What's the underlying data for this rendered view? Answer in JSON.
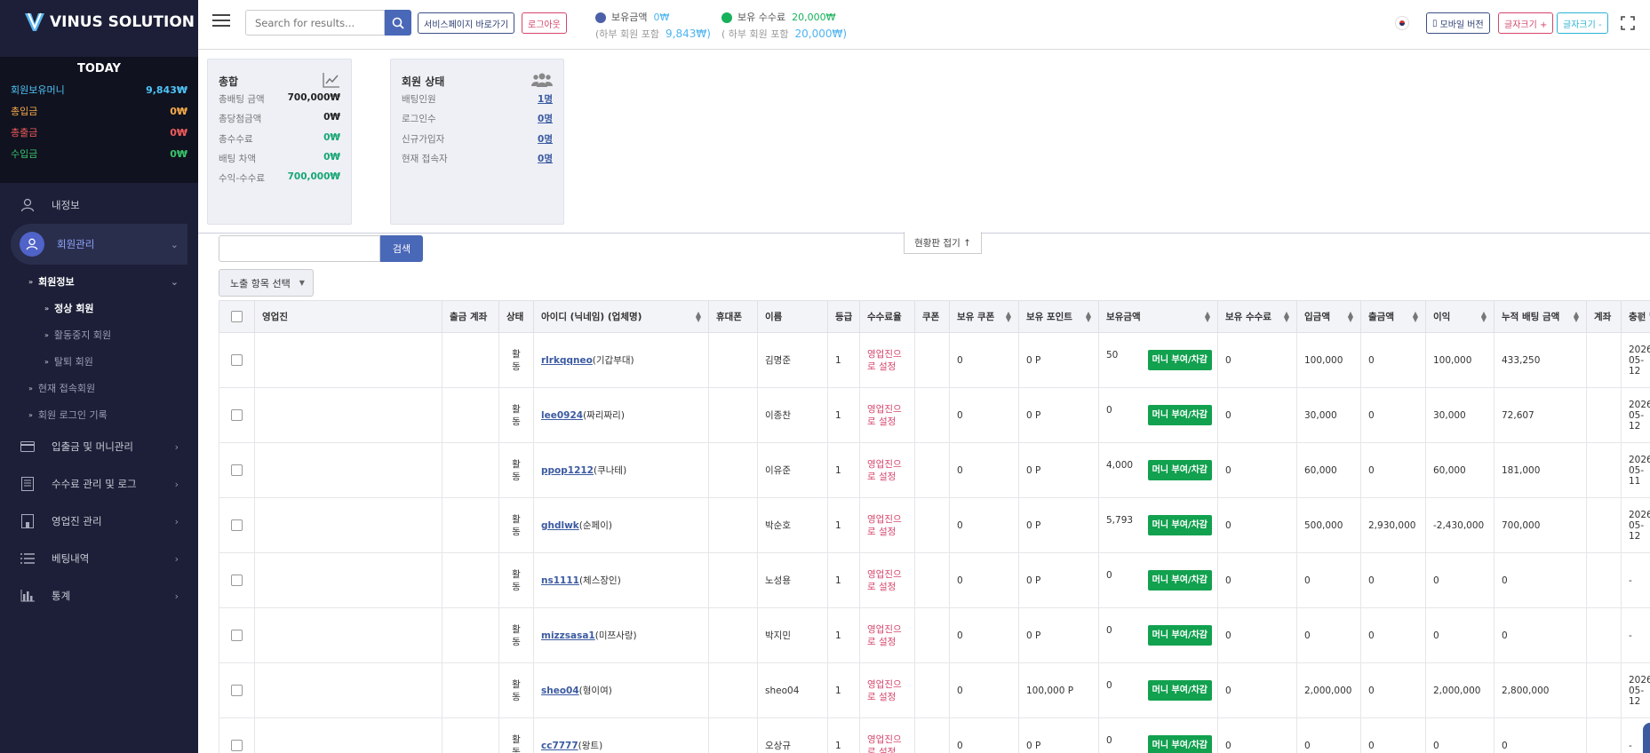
{
  "brand": {
    "name": "VINUS SOLUTION"
  },
  "today": {
    "title": "TODAY",
    "rows": [
      {
        "label": "회원보유머니",
        "value": "9,843₩",
        "color": "#4fc3f7"
      },
      {
        "label": "총입금",
        "value": "0₩",
        "color": "#f5a94a"
      },
      {
        "label": "총출금",
        "value": "0₩",
        "color": "#ef5b5b"
      },
      {
        "label": "수입금",
        "value": "0₩",
        "color": "#37c36b"
      }
    ]
  },
  "menu": {
    "myinfo": "내정보",
    "members": "회원관리",
    "member_info": "회원정보",
    "normal": "정상 회원",
    "suspended": "활동중지 회원",
    "withdrawn": "탈퇴 회원",
    "current": "현재 접속회원",
    "login_log": "회원 로그인 기록",
    "money": "입출금 및 머니관리",
    "fee": "수수료 관리 및 로그",
    "agency": "영업진 관리",
    "betting": "베팅내역",
    "stats": "통계"
  },
  "topbar": {
    "search_placeholder": "Search for results...",
    "service_btn": "서비스페이지 바로가기",
    "logout_btn": "로그아웃",
    "hold_amount_label": "보유금액",
    "hold_amount_value": "0₩",
    "hold_amount_sub": "(하부 회원 포함",
    "hold_amount_sub_value": "9,843₩)",
    "hold_fee_label": "보유 수수료",
    "hold_fee_value": "20,000₩",
    "hold_fee_sub": "( 하부 회원 포함",
    "hold_fee_sub_value": "20,000₩)",
    "mobile_btn": "모바일 버전",
    "font_up": "글자크기 +",
    "font_down": "글자크기 -"
  },
  "summary": {
    "title": "총합",
    "rows": [
      {
        "label": "총배팅 금액",
        "value": "700,000₩",
        "color": "#222"
      },
      {
        "label": "총당첨금액",
        "value": "0₩",
        "color": "#222"
      },
      {
        "label": "총수수료",
        "value": "0₩",
        "color": "#17a673"
      },
      {
        "label": "배팅 차액",
        "value": "0₩",
        "color": "#17a673"
      },
      {
        "label": "수익-수수료",
        "value": "700,000₩",
        "color": "#17a673"
      }
    ]
  },
  "member_status": {
    "title": "회원 상태",
    "rows": [
      {
        "label": "배팅인원",
        "value": "1명"
      },
      {
        "label": "로그인수",
        "value": "0명"
      },
      {
        "label": "신규가입자",
        "value": "0명"
      },
      {
        "label": "현재 접속자",
        "value": "0명"
      }
    ]
  },
  "fold_label": "현황판 접기 ↑",
  "filter": {
    "search_btn": "검색",
    "column_select": "노출 항목 선택"
  },
  "table": {
    "headers": [
      "영업진",
      "출금 계좌",
      "상태",
      "아이디 (닉네임) (업체명)",
      "휴대폰",
      "이름",
      "등급",
      "수수료율",
      "쿠폰",
      "보유 쿠폰",
      "보유 포인트",
      "보유금액",
      "보유 수수료",
      "입금액",
      "출금액",
      "이익",
      "누적 배팅 금액",
      "계좌",
      "충전 날짜"
    ],
    "money_btn": "머니 부여/차감",
    "rows": [
      {
        "status": "활동",
        "id": "rlrkqqneo",
        "nick": "(기갑부대)",
        "name": "김명준",
        "grade": "1",
        "rate": "영업진으로 설정",
        "coupon": "0",
        "point": "0 P",
        "money": "50",
        "fee": "0",
        "deposit": "100,000",
        "withdraw": "0",
        "profit": "100,000",
        "bet": "433,250",
        "date": "2026-05-12"
      },
      {
        "status": "활동",
        "id": "lee0924",
        "nick": "(짜리짜리)",
        "name": "이종찬",
        "grade": "1",
        "rate": "영업진으로 설정",
        "coupon": "0",
        "point": "0 P",
        "money": "0",
        "fee": "0",
        "deposit": "30,000",
        "withdraw": "0",
        "profit": "30,000",
        "bet": "72,607",
        "date": "2026-05-12"
      },
      {
        "status": "활동",
        "id": "ppop1212",
        "nick": "(쿠나테)",
        "name": "이유준",
        "grade": "1",
        "rate": "영업진으로 설정",
        "coupon": "0",
        "point": "0 P",
        "money": "4,000",
        "fee": "0",
        "deposit": "60,000",
        "withdraw": "0",
        "profit": "60,000",
        "bet": "181,000",
        "date": "2026-05-11"
      },
      {
        "status": "활동",
        "id": "ghdlwk",
        "nick": "(순페이)",
        "name": "박순호",
        "grade": "1",
        "rate": "영업진으로 설정",
        "coupon": "0",
        "point": "0 P",
        "money": "5,793",
        "fee": "0",
        "deposit": "500,000",
        "withdraw": "2,930,000",
        "profit": "-2,430,000",
        "bet": "700,000",
        "date": "2026-05-12"
      },
      {
        "status": "활동",
        "id": "ns1111",
        "nick": "(체스장인)",
        "name": "노성용",
        "grade": "1",
        "rate": "영업진으로 설정",
        "coupon": "0",
        "point": "0 P",
        "money": "0",
        "fee": "0",
        "deposit": "0",
        "withdraw": "0",
        "profit": "0",
        "bet": "0",
        "date": "-"
      },
      {
        "status": "활동",
        "id": "mizzsasa1",
        "nick": "(미쯔사랑)",
        "name": "박지민",
        "grade": "1",
        "rate": "영업진으로 설정",
        "coupon": "0",
        "point": "0 P",
        "money": "0",
        "fee": "0",
        "deposit": "0",
        "withdraw": "0",
        "profit": "0",
        "bet": "0",
        "date": "-"
      },
      {
        "status": "활동",
        "id": "sheo04",
        "nick": "(형이여)",
        "name": "sheo04",
        "grade": "1",
        "rate": "영업진으로 설정",
        "coupon": "0",
        "point": "100,000 P",
        "money": "0",
        "fee": "0",
        "deposit": "2,000,000",
        "withdraw": "0",
        "profit": "2,000,000",
        "bet": "2,800,000",
        "date": "2026-05-12"
      },
      {
        "status": "활동",
        "id": "cc7777",
        "nick": "(왕트)",
        "name": "오상규",
        "grade": "1",
        "rate": "영업진으로 설정",
        "coupon": "0",
        "point": "0 P",
        "money": "0",
        "fee": "0",
        "deposit": "0",
        "withdraw": "0",
        "profit": "0",
        "bet": "0",
        "date": "-"
      }
    ]
  }
}
